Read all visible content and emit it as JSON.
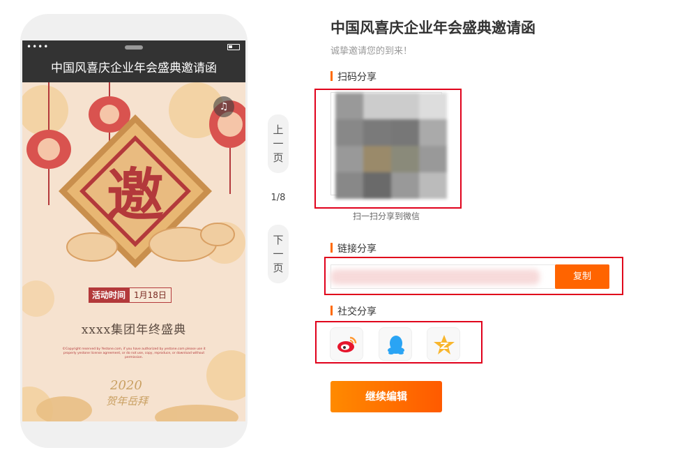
{
  "phone": {
    "status_dots": "••••",
    "title": "中国风喜庆企业年会盛典邀请函",
    "poster": {
      "big_char": "邀",
      "activity_label": "活动时间",
      "activity_date": "1月18日",
      "group_name": "xxxx集团年终盛典",
      "copyright": "©Copyright reserved by Yestone.com, if you have authorized by yestone.com please use it properly yestone license agreement, or do not use, copy, reproduce, or download without permission.",
      "stamp_year": "2020",
      "stamp_text": "贺年岳拜"
    }
  },
  "pager": {
    "prev": [
      "上",
      "一",
      "页"
    ],
    "counter": "1/8",
    "next": [
      "下",
      "一",
      "页"
    ]
  },
  "panel": {
    "title": "中国风喜庆企业年会盛典邀请函",
    "subtitle": "诚挚邀请您的到来！",
    "qr_section": "扫码分享",
    "qr_caption": "扫一扫分享到微信",
    "link_section": "链接分享",
    "link_value": "",
    "copy_label": "复制",
    "social_section": "社交分享",
    "social_icons": [
      "weibo-icon",
      "qq-icon",
      "qzone-icon"
    ],
    "edit_label": "继续编辑"
  },
  "colors": {
    "accent": "#ff6400",
    "highlight": "#e0001b",
    "poster_red": "#b3393b",
    "poster_bg": "#f6e2cf"
  }
}
